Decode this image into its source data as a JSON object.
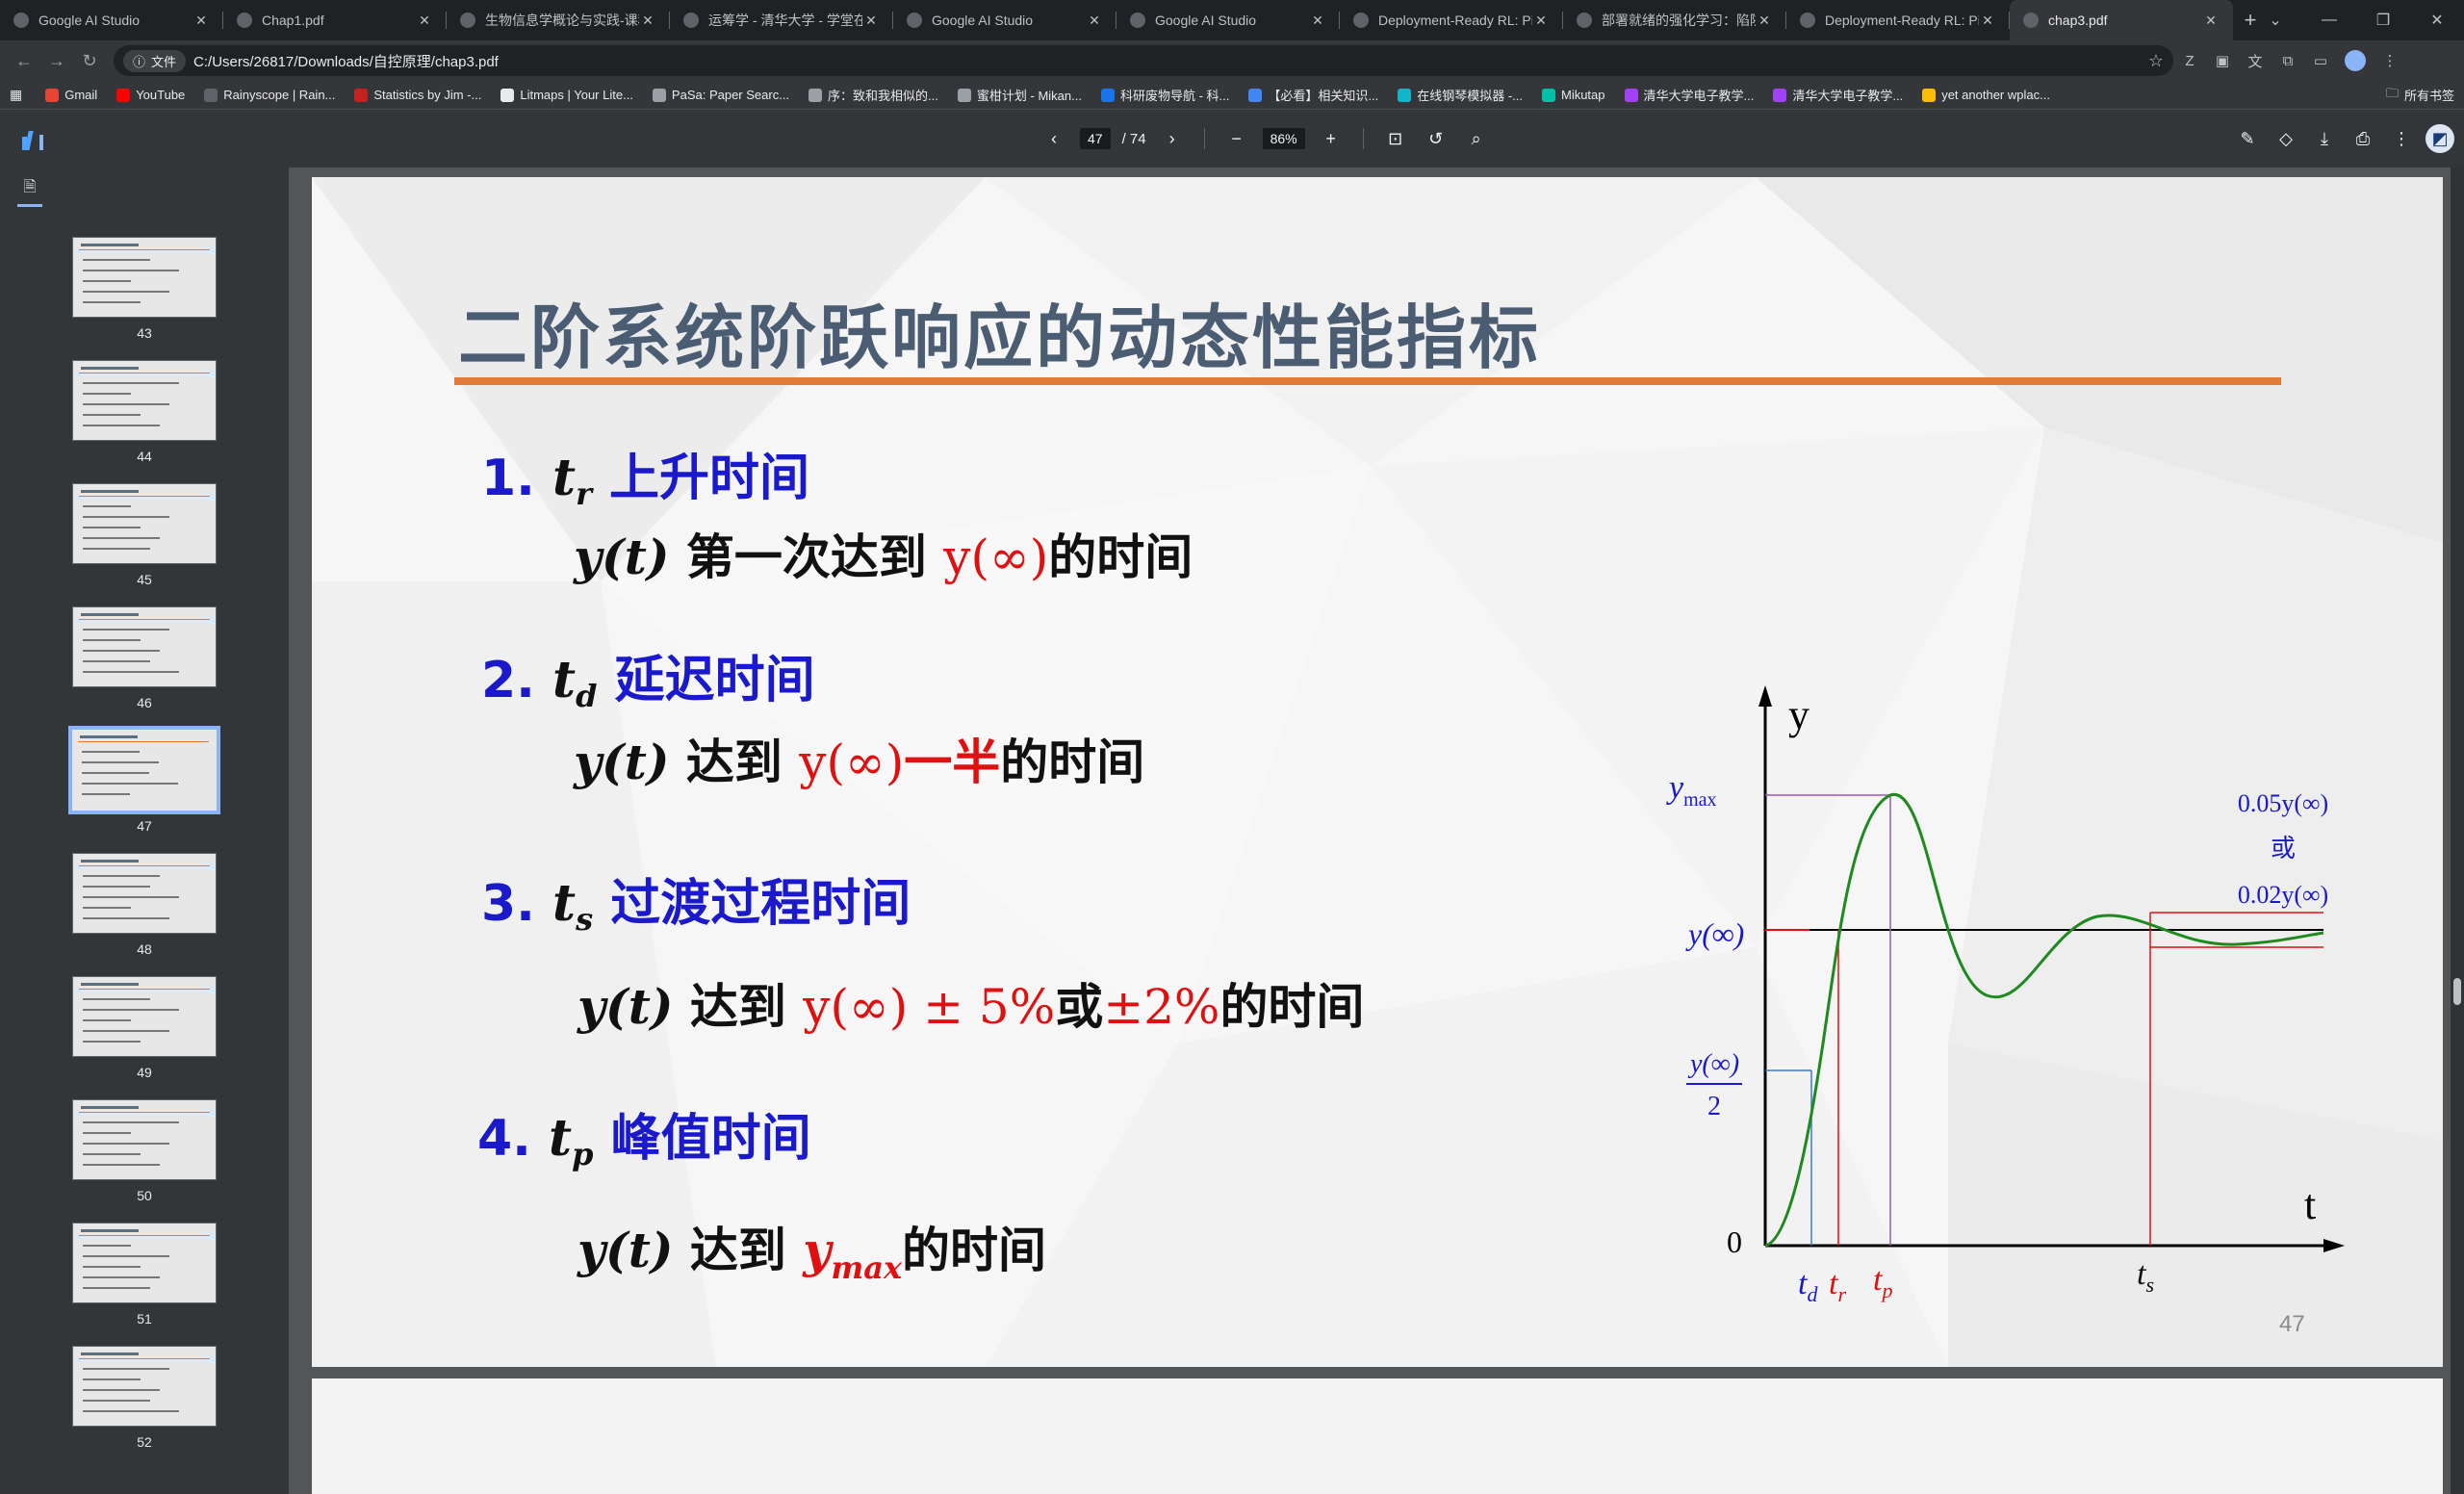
{
  "browser": {
    "tabs": [
      {
        "title": "Google AI Studio",
        "active": false
      },
      {
        "title": "Chap1.pdf",
        "active": false
      },
      {
        "title": "生物信息学概论与实践-课程主",
        "active": false
      },
      {
        "title": "运筹学 - 清华大学 - 学堂在线",
        "active": false
      },
      {
        "title": "Google AI Studio",
        "active": false
      },
      {
        "title": "Google AI Studio",
        "active": false
      },
      {
        "title": "Deployment-Ready RL: Pitfa",
        "active": false
      },
      {
        "title": "部署就绪的强化学习：陷阱、",
        "active": false
      },
      {
        "title": "Deployment-Ready RL: Pitfa",
        "active": false
      },
      {
        "title": "chap3.pdf",
        "active": true
      }
    ],
    "address": {
      "chip": "文件",
      "url": "C:/Users/26817/Downloads/自控原理/chap3.pdf"
    },
    "bookmarks": [
      {
        "label": "Gmail",
        "color": "#ea4335"
      },
      {
        "label": "YouTube",
        "color": "#ff0000"
      },
      {
        "label": "Rainyscope | Rain...",
        "color": "#5f6368"
      },
      {
        "label": "Statistics by Jim -...",
        "color": "#c5221f"
      },
      {
        "label": "Litmaps | Your Lite...",
        "color": "#e8eaed"
      },
      {
        "label": "PaSa: Paper Searc...",
        "color": "#9aa0a6"
      },
      {
        "label": "序：致和我相似的...",
        "color": "#9aa0a6"
      },
      {
        "label": "蜜柑计划 - Mikan...",
        "color": "#9aa0a6"
      },
      {
        "label": "科研废物导航 - 科...",
        "color": "#1a73e8"
      },
      {
        "label": "【必看】相关知识...",
        "color": "#4285f4"
      },
      {
        "label": "在线钢琴模拟器 -...",
        "color": "#12b5cb"
      },
      {
        "label": "Mikutap",
        "color": "#00bfa5"
      },
      {
        "label": "清华大学电子教学...",
        "color": "#a142f4"
      },
      {
        "label": "清华大学电子教学...",
        "color": "#a142f4"
      },
      {
        "label": "yet another wplac...",
        "color": "#fbbc04"
      }
    ],
    "all_bookmarks": "所有书签"
  },
  "pdf_viewer": {
    "current_page": "47",
    "total_pages": "/ 74",
    "zoom": "86%"
  },
  "sidebar": {
    "thumbnails": [
      {
        "page": "43",
        "active": false
      },
      {
        "page": "44",
        "active": false
      },
      {
        "page": "45",
        "active": false
      },
      {
        "page": "46",
        "active": false
      },
      {
        "page": "47",
        "active": true
      },
      {
        "page": "48",
        "active": false
      },
      {
        "page": "49",
        "active": false
      },
      {
        "page": "50",
        "active": false
      },
      {
        "page": "51",
        "active": false
      },
      {
        "page": "52",
        "active": false
      }
    ]
  },
  "slide": {
    "title": "二阶系统阶跃响应的动态性能指标",
    "page_number": "47",
    "items": [
      {
        "num": "1.",
        "var": "t",
        "sub": "r",
        "name": "上升时间",
        "body": {
          "y": "y(t)",
          "a": " 第一次达到 ",
          "inf": "y(∞)",
          "b": "的时间"
        }
      },
      {
        "num": "2.",
        "var": "t",
        "sub": "d",
        "name": "延迟时间",
        "body": {
          "y": "y(t)",
          "a": " 达到 ",
          "inf": "y(∞)",
          "half": "一半",
          "b": "的时间"
        }
      },
      {
        "num": "3.",
        "var": "t",
        "sub": "s",
        "name": "过渡过程时间",
        "body": {
          "y": "y(t)",
          "a": " 达到 ",
          "inf": "y(∞) ± 5%",
          "or": "或",
          "pct": "±2%",
          "b": "的时间"
        }
      },
      {
        "num": "4.",
        "var": "t",
        "sub": "p",
        "name": "峰值时间",
        "body": {
          "y": "y(t)",
          "a": " 达到 ",
          "ymax": "y",
          "ymax_sub": "max",
          "b": "的时间"
        }
      }
    ],
    "figure": {
      "y_axis": "y",
      "x_axis": "t",
      "origin": "0",
      "ymax_label": "y",
      "ymax_sub": "max",
      "yinf_label": "y(∞)",
      "half_num": "y(∞)",
      "half_den": "2",
      "band_top": "0.05y(∞)",
      "band_or": "或",
      "band_bottom": "0.02y(∞)",
      "td": "t",
      "td_sub": "d",
      "tr": "t",
      "tr_sub": "r",
      "tp": "t",
      "tp_sub": "p",
      "ts": "t",
      "ts_sub": "s"
    }
  }
}
